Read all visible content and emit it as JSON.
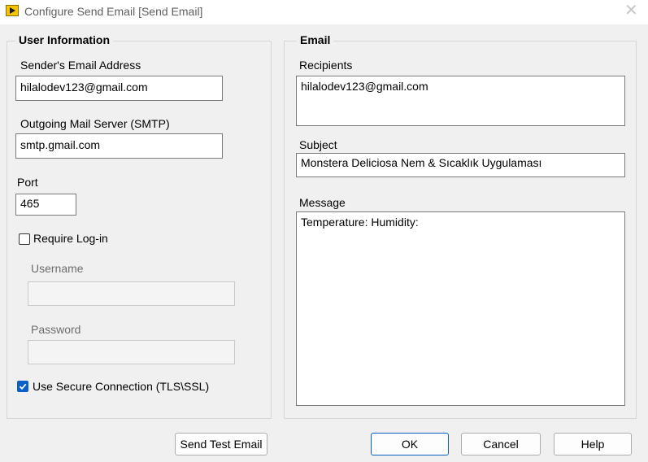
{
  "window": {
    "title": "Configure Send Email [Send Email]",
    "close_glyph": "✕",
    "app_icon": "labview-run-icon"
  },
  "user_info": {
    "title": "User Information",
    "sender_label": "Sender's Email Address",
    "sender_value": "hilalodev123@gmail.com",
    "smtp_label": "Outgoing Mail Server (SMTP)",
    "smtp_value": "smtp.gmail.com",
    "port_label": "Port",
    "port_value": "465",
    "require_login_label": "Require Log-in",
    "require_login_checked": false,
    "username_label": "Username",
    "username_value": "",
    "password_label": "Password",
    "password_value": "",
    "secure_label": "Use Secure Connection (TLS\\SSL)",
    "secure_checked": true
  },
  "email": {
    "title": "Email",
    "recipients_label": "Recipients",
    "recipients_value": "hilalodev123@gmail.com",
    "subject_label": "Subject",
    "subject_value": "Monstera Deliciosa Nem & Sıcaklık Uygulaması",
    "message_label": "Message",
    "message_value": "Temperature:  Humidity:"
  },
  "buttons": {
    "send_test": "Send Test Email",
    "ok": "OK",
    "cancel": "Cancel",
    "help": "Help"
  },
  "colors": {
    "accent": "#0a5fc8",
    "window_bg": "#f0f0f0"
  }
}
